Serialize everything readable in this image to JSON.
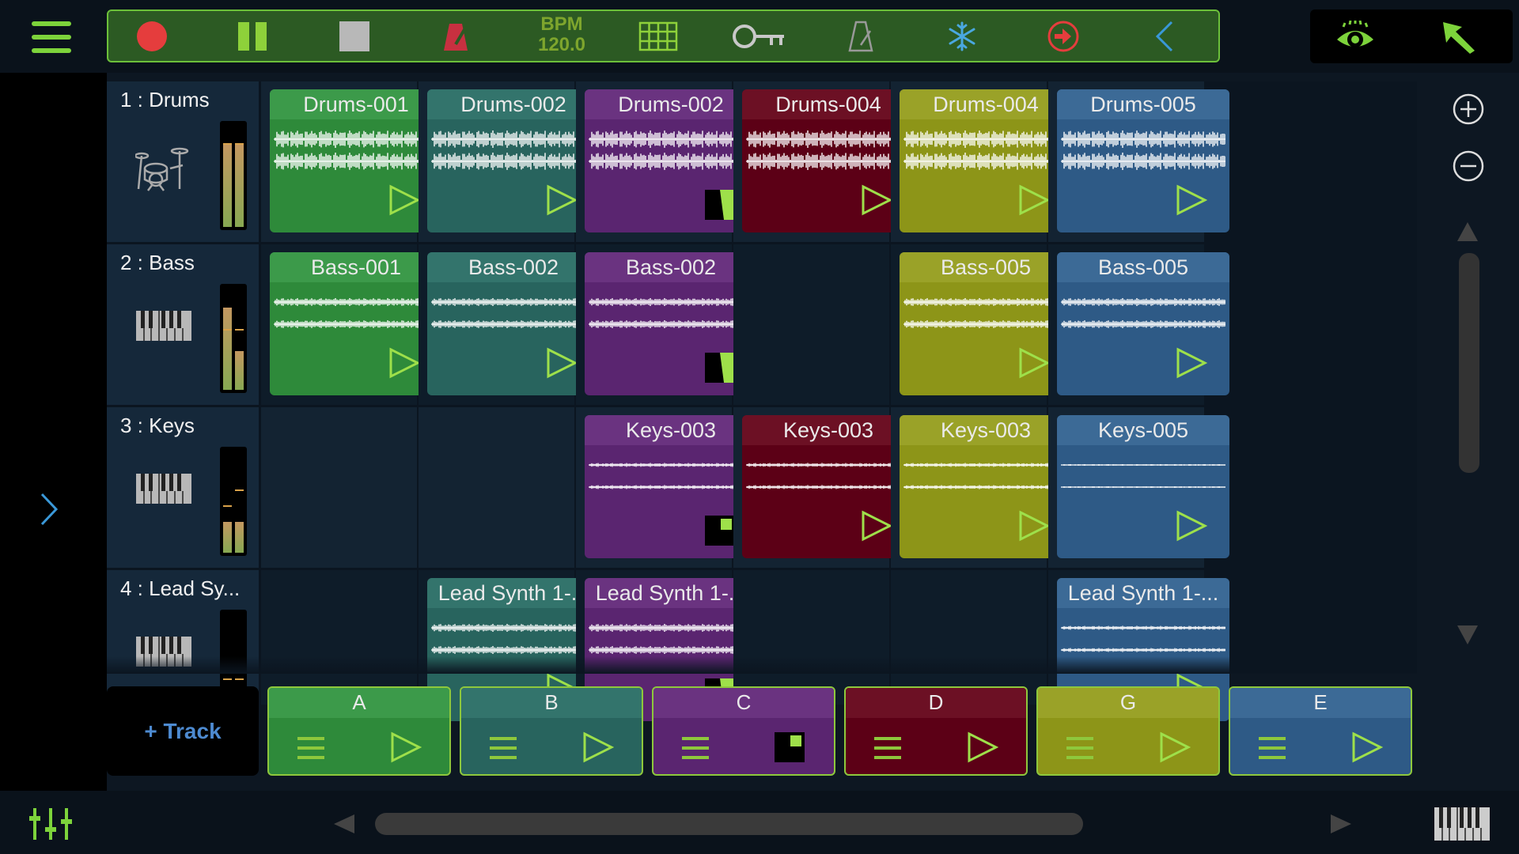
{
  "app": {
    "accent": "#7dd33b"
  },
  "toolbar": {
    "bpm_label": "BPM",
    "bpm_value": "120.0",
    "buttons": [
      "record-icon",
      "pause-icon",
      "stop-icon",
      "metronome-icon",
      "bpm",
      "grid-icon",
      "key-icon",
      "tuner-icon",
      "snowflake-icon",
      "arrow-right-circle-icon",
      "chevron-left-icon"
    ]
  },
  "tracks": [
    {
      "name": "1 : Drums",
      "icon": "drum-kit-icon",
      "meter": [
        0.8,
        0.8
      ],
      "peaks": [
        0.8,
        0.8
      ]
    },
    {
      "name": "2 : Bass",
      "icon": "piano-keys-icon",
      "meter": [
        0.8,
        0.38
      ],
      "peaks": [
        0.58,
        0.58
      ]
    },
    {
      "name": "3 : Keys",
      "icon": "piano-keys-icon",
      "meter": [
        0.3,
        0.3
      ],
      "peaks": [
        0.45,
        0.6
      ]
    },
    {
      "name": "4 : Lead Sy...",
      "icon": "piano-keys-icon",
      "meter": [
        0.22,
        0.22
      ],
      "peaks": [
        0.35,
        0.35
      ]
    }
  ],
  "clips": [
    [
      {
        "label": "Drums-001",
        "color": "green",
        "state": "play",
        "wave": "dense"
      },
      {
        "label": "Drums-002",
        "color": "teal",
        "state": "play",
        "wave": "dense"
      },
      {
        "label": "Drums-002",
        "color": "purple",
        "state": "progress",
        "wave": "dense"
      },
      {
        "label": "Drums-004",
        "color": "red",
        "state": "play",
        "wave": "dense"
      },
      {
        "label": "Drums-004",
        "color": "olive",
        "state": "play",
        "wave": "dense"
      },
      {
        "label": "Drums-005",
        "color": "blue",
        "state": "play",
        "wave": "dense"
      }
    ],
    [
      {
        "label": "Bass-001",
        "color": "green",
        "state": "play",
        "wave": "mid"
      },
      {
        "label": "Bass-002",
        "color": "teal",
        "state": "play",
        "wave": "mid"
      },
      {
        "label": "Bass-002",
        "color": "purple",
        "state": "progress",
        "wave": "mid"
      },
      null,
      {
        "label": "Bass-005",
        "color": "olive",
        "state": "play",
        "wave": "mid"
      },
      {
        "label": "Bass-005",
        "color": "blue",
        "state": "play",
        "wave": "mid"
      }
    ],
    [
      null,
      null,
      {
        "label": "Keys-003",
        "color": "purple",
        "state": "progress",
        "wave": "thin"
      },
      {
        "label": "Keys-003",
        "color": "red",
        "state": "play",
        "wave": "thin"
      },
      {
        "label": "Keys-003",
        "color": "olive",
        "state": "play",
        "wave": "thin"
      },
      {
        "label": "Keys-005",
        "color": "blue",
        "state": "play",
        "wave": "line"
      }
    ],
    [
      null,
      {
        "label": "Lead Synth 1-...",
        "color": "teal",
        "state": "play",
        "wave": "mid"
      },
      {
        "label": "Lead Synth 1-...",
        "color": "purple",
        "state": "progress",
        "wave": "mid"
      },
      null,
      null,
      {
        "label": "Lead Synth 1-...",
        "color": "blue",
        "state": "play",
        "wave": "thin"
      }
    ]
  ],
  "add_track_label": "+ Track",
  "scenes": [
    {
      "label": "A",
      "color": "green",
      "state": "play"
    },
    {
      "label": "B",
      "color": "teal",
      "state": "play"
    },
    {
      "label": "C",
      "color": "purple",
      "state": "progress"
    },
    {
      "label": "D",
      "color": "red",
      "state": "play"
    },
    {
      "label": "G",
      "color": "olive",
      "state": "play"
    },
    {
      "label": "E",
      "color": "blue",
      "state": "play"
    }
  ],
  "colors": {
    "accent": "#7dd33b",
    "record": "#e53d3d",
    "play_arrow": "#9ee04a"
  }
}
